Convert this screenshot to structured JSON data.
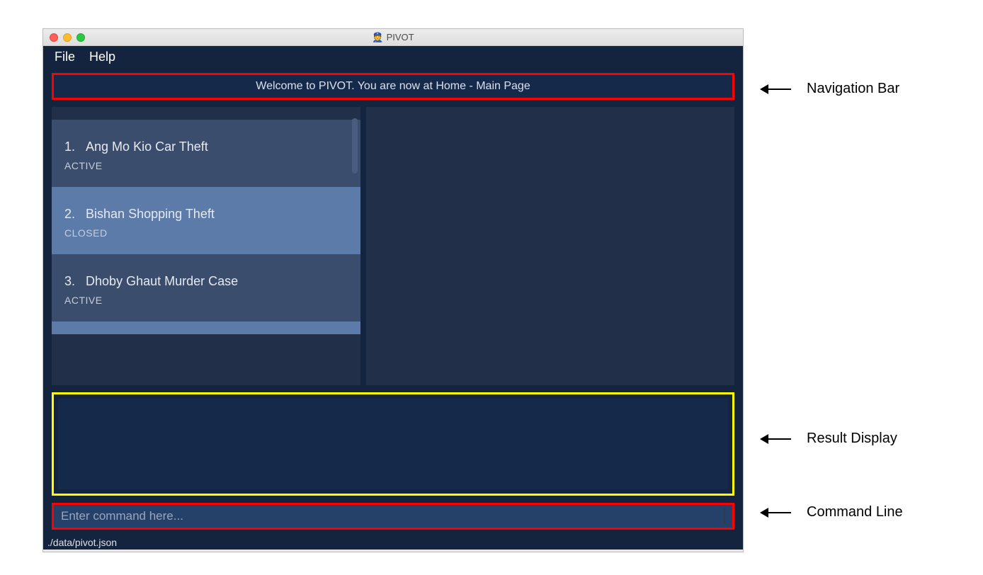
{
  "window": {
    "title": "PIVOT",
    "icon": "👮"
  },
  "menubar": {
    "file": "File",
    "help": "Help"
  },
  "navbar": {
    "message": "Welcome to PIVOT. You are now at Home - Main Page"
  },
  "cases": [
    {
      "index": "1.",
      "title": "Ang Mo Kio Car Theft",
      "status": "ACTIVE"
    },
    {
      "index": "2.",
      "title": "Bishan Shopping Theft",
      "status": "CLOSED"
    },
    {
      "index": "3.",
      "title": "Dhoby Ghaut Murder Case",
      "status": "ACTIVE"
    }
  ],
  "command": {
    "placeholder": "Enter command here..."
  },
  "status_strip": "./data/pivot.json",
  "annotations": {
    "navbar": "Navigation Bar",
    "result": "Result Display",
    "command": "Command Line"
  }
}
